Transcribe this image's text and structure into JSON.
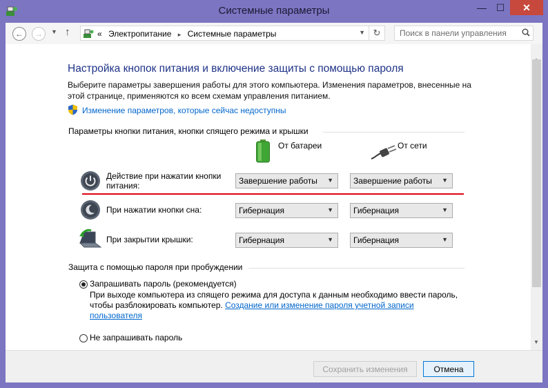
{
  "window": {
    "title": "Системные параметры",
    "controls": {
      "minimize": "—",
      "maximize": "☐",
      "close": "✕"
    }
  },
  "address_bar": {
    "prefix": "«",
    "path": [
      "Электропитание",
      "Системные параметры"
    ],
    "separator": "▸"
  },
  "search": {
    "placeholder": "Поиск в панели управления"
  },
  "page": {
    "heading": "Настройка кнопок питания и включение защиты с помощью пароля",
    "description": "Выберите параметры завершения работы для этого компьютера. Изменения параметров, внесенные на этой странице, применяются ко всем схемам управления питанием.",
    "unavailable_link": "Изменение параметров, которые сейчас недоступны",
    "buttons_section": {
      "title": "Параметры кнопки питания, кнопки спящего режима и крышки",
      "col_battery": "От батареи",
      "col_ac": "От сети",
      "rows": [
        {
          "label": "Действие при нажатии кнопки питания:",
          "battery": "Завершение работы",
          "ac": "Завершение работы"
        },
        {
          "label": "При нажатии кнопки сна:",
          "battery": "Гибернация",
          "ac": "Гибернация"
        },
        {
          "label": "При закрытии крышки:",
          "battery": "Гибернация",
          "ac": "Гибернация"
        }
      ]
    },
    "password_section": {
      "title": "Защита с помощью пароля при пробуждении",
      "require_label": "Запрашивать пароль (рекомендуется)",
      "require_desc": "При выходе компьютера из спящего режима для доступа к данным необходимо ввести пароль, чтобы разблокировать компьютер.",
      "require_link": "Создание или изменение пароля учетной записи пользователя",
      "no_require_label": "Не запрашивать пароль",
      "require_selected": true
    }
  },
  "footer": {
    "save": "Сохранить изменения",
    "cancel": "Отмена"
  },
  "colors": {
    "frame": "#7c75c2",
    "heading": "#1e3287",
    "link": "#0066cc",
    "highlight_line": "#e0000f",
    "close_button": "#c7483d"
  }
}
